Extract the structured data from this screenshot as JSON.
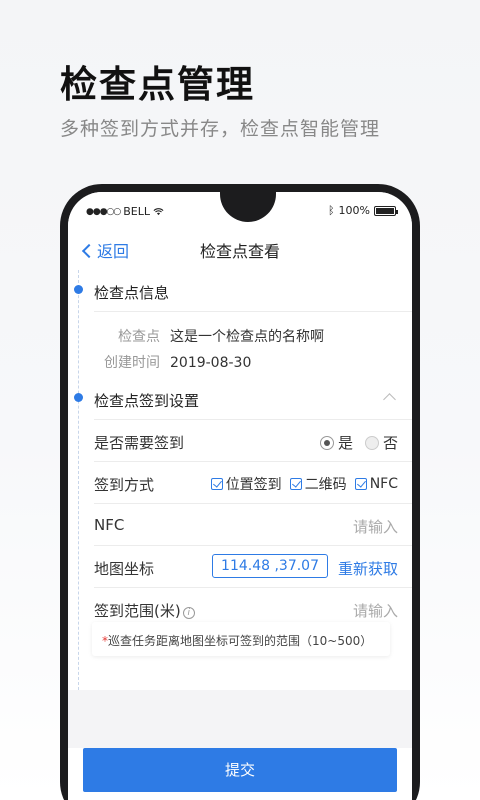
{
  "promo": {
    "title": "检查点管理",
    "subtitle": "多种签到方式并存，检查点智能管理"
  },
  "status_bar": {
    "carrier": "BELL",
    "battery": "100%"
  },
  "nav": {
    "back_label": "返回",
    "title": "检查点查看"
  },
  "info_section": {
    "title": "检查点信息",
    "rows": [
      {
        "key": "检查点",
        "value": "这是一个检查点的名称啊"
      },
      {
        "key": "创建时间",
        "value": "2019-08-30"
      }
    ]
  },
  "signin_section": {
    "title": "检查点签到设置",
    "need_signin": {
      "label": "是否需要签到",
      "options": [
        "是",
        "否"
      ],
      "selected": "是"
    },
    "signin_method": {
      "label": "签到方式",
      "options": [
        "位置签到",
        "二维码",
        "NFC"
      ]
    },
    "nfc": {
      "label": "NFC",
      "placeholder": "请输入"
    },
    "map_coord": {
      "label": "地图坐标",
      "value": "114.48 ,37.07",
      "action": "重新获取"
    },
    "range": {
      "label": "签到范围(米)",
      "placeholder": "请输入"
    }
  },
  "note": {
    "star": "*",
    "text": "巡查任务距离地图坐标可签到的范围（10~500）"
  },
  "footer": {
    "submit_label": "提交"
  },
  "colors": {
    "accent": "#2e7be5",
    "required": "#e53935"
  }
}
